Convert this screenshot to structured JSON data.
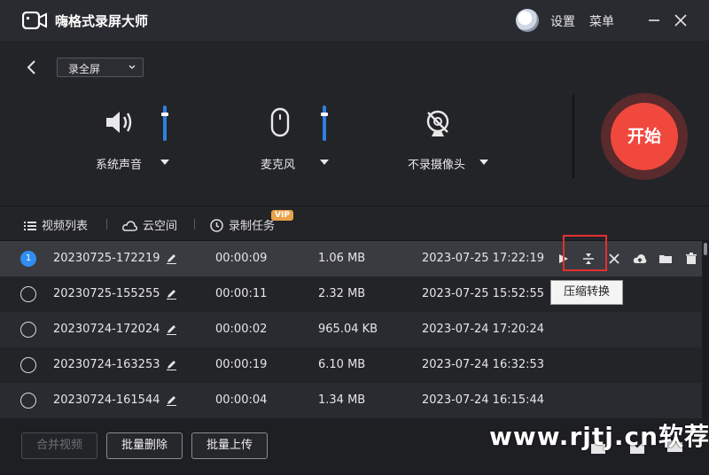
{
  "app": {
    "title": "嗨格式录屏大师",
    "settings_label": "设置",
    "menu_label": "菜单"
  },
  "capture": {
    "mode_selected": "录全屏",
    "sources": [
      {
        "label": "系统声音",
        "icon": "speaker-icon"
      },
      {
        "label": "麦克风",
        "icon": "microphone-icon"
      },
      {
        "label": "不录摄像头",
        "icon": "camera-off-icon"
      }
    ],
    "start_label": "开始",
    "accent": "#f0483d"
  },
  "tabs": [
    {
      "label": "视频列表",
      "icon": "list-icon"
    },
    {
      "label": "云空间",
      "icon": "cloud-icon"
    },
    {
      "label": "录制任务",
      "icon": "clock-icon",
      "badge": "VIP"
    }
  ],
  "recordings": [
    {
      "index": "1",
      "name": "20230725-172219",
      "duration": "00:00:09",
      "size": "1.06 MB",
      "date": "2023-07-25 17:22:19",
      "selected": true
    },
    {
      "name": "20230725-155255",
      "duration": "00:00:11",
      "size": "2.32 MB",
      "date": "2023-07-25 15:52:55"
    },
    {
      "name": "20230724-172024",
      "duration": "00:00:02",
      "size": "965.04 KB",
      "date": "2023-07-24 17:20:24"
    },
    {
      "name": "20230724-163253",
      "duration": "00:00:19",
      "size": "6.10 MB",
      "date": "2023-07-24 16:32:53"
    },
    {
      "name": "20230724-161544",
      "duration": "00:00:04",
      "size": "1.34 MB",
      "date": "2023-07-24 16:15:44"
    }
  ],
  "tooltip": "压缩转换",
  "footer": {
    "merge_label": "合并视频",
    "batch_delete_label": "批量删除",
    "batch_upload_label": "批量上传"
  },
  "watermark": "www.rjtj.cn软荐网"
}
